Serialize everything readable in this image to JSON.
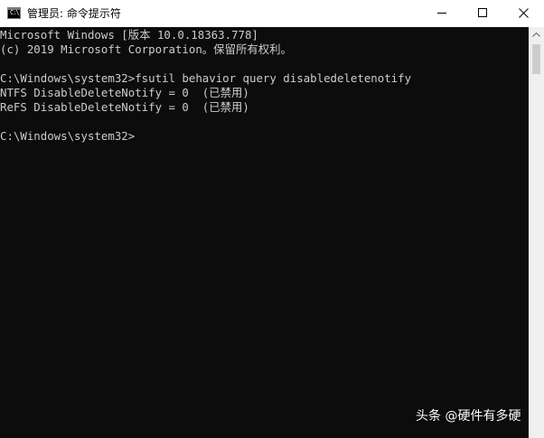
{
  "window": {
    "title": "管理员: 命令提示符",
    "icon": "cmd-icon",
    "icon_text": "C:\\"
  },
  "console": {
    "lines": [
      "Microsoft Windows [版本 10.0.18363.778]",
      "(c) 2019 Microsoft Corporation。保留所有权利。",
      "",
      "C:\\Windows\\system32>fsutil behavior query disabledeletenotify",
      "NTFS DisableDeleteNotify = 0  (已禁用)",
      "ReFS DisableDeleteNotify = 0  (已禁用)",
      "",
      "C:\\Windows\\system32>"
    ]
  },
  "watermark": {
    "text": "头条 @硬件有多硬"
  },
  "colors": {
    "console_background": "#0c0c0c",
    "console_text": "#cccccc",
    "titlebar_background": "#ffffff"
  }
}
